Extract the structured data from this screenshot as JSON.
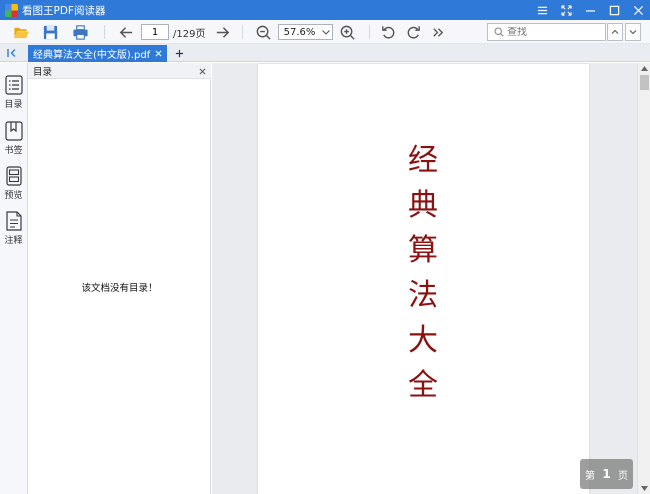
{
  "window": {
    "title": "看图王PDF阅读器"
  },
  "toolbar": {
    "page_current": "1",
    "page_total": "/129页",
    "zoom_value": "57.6%",
    "search_placeholder": "查找"
  },
  "tabs": [
    {
      "label": "经典算法大全(中文版).pdf",
      "active": true
    }
  ],
  "sidebar": {
    "items": [
      {
        "label": "目录",
        "icon": "list-icon",
        "active": true
      },
      {
        "label": "书签",
        "icon": "bookmark-icon",
        "active": false
      },
      {
        "label": "预览",
        "icon": "thumbnail-icon",
        "active": false
      },
      {
        "label": "注释",
        "icon": "annotation-icon",
        "active": false
      }
    ]
  },
  "panel": {
    "title": "目录",
    "empty_message": "该文档没有目录！"
  },
  "document": {
    "title_chars": [
      "经",
      "典",
      "算",
      "法",
      "大",
      "全"
    ],
    "title_color": "#8b1010"
  },
  "page_indicator": {
    "prefix": "第",
    "number": "1",
    "suffix": "页"
  },
  "colors": {
    "accent": "#2f7ad9",
    "toolbar_bg": "#f5f7fa",
    "doc_bg": "#e9ebee"
  }
}
